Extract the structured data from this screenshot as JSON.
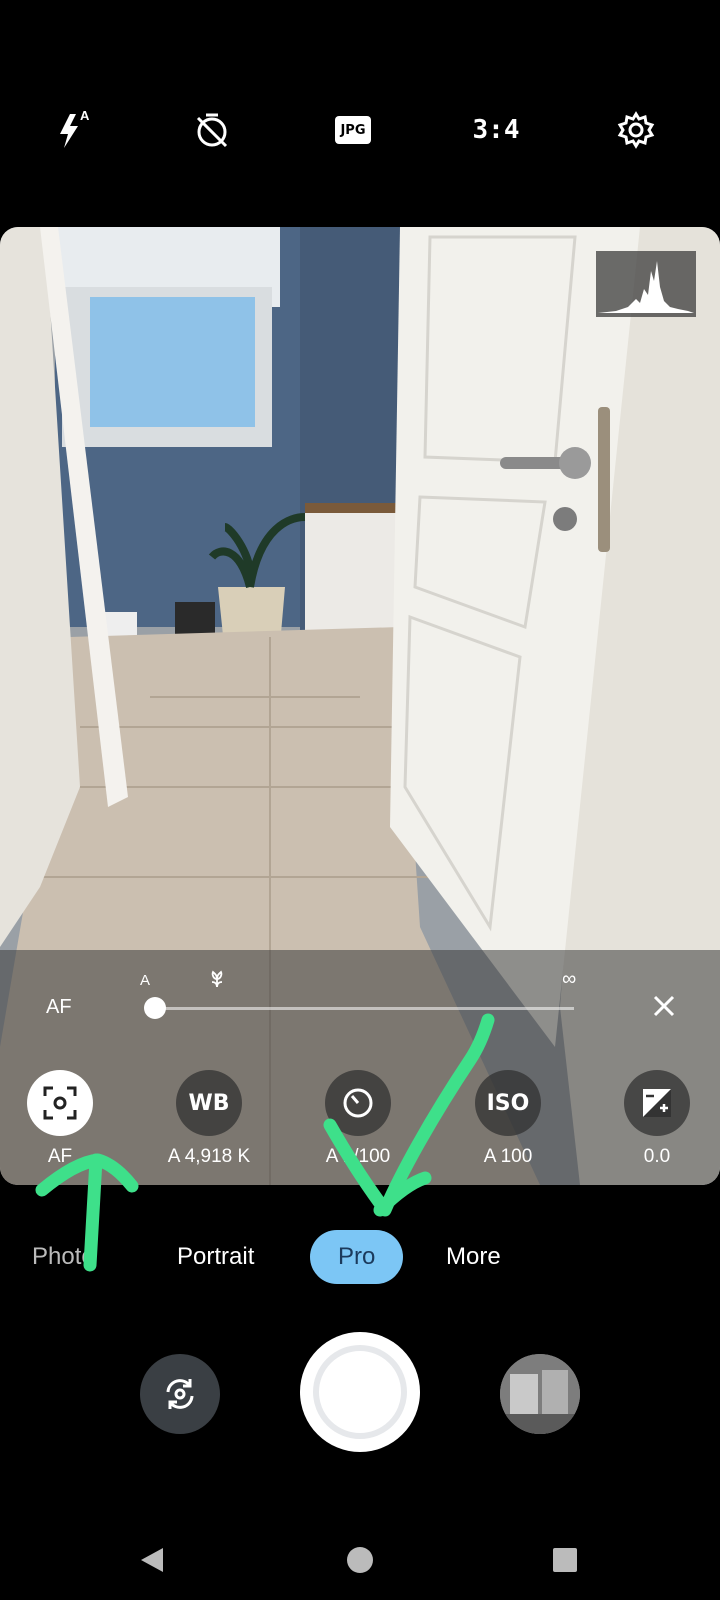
{
  "topbar": {
    "flash_icon": "flash-auto-icon",
    "flash_badge": "A",
    "timer_icon": "timer-off-icon",
    "format_label": "JPG",
    "aspect_ratio": "3:4",
    "settings_icon": "gear-icon"
  },
  "pro_panel": {
    "focus_mode_label": "AF",
    "slider_auto_label": "A",
    "slider_macro_icon": "flower-macro-icon",
    "slider_infinity_label": "∞",
    "close_icon": "close-icon",
    "focus_position": 0.02,
    "controls": [
      {
        "name": "AF",
        "icon": "focus-frame-icon",
        "value": "AF",
        "active": true
      },
      {
        "name": "WB",
        "label": "WB",
        "value": "A 4,918 K",
        "active": false
      },
      {
        "name": "shutter",
        "icon": "shutter-speed-icon",
        "value": "A 1/100",
        "active": false
      },
      {
        "name": "ISO",
        "label": "ISO",
        "value": "A 100",
        "active": false
      },
      {
        "name": "exposure",
        "icon": "exposure-compensation-icon",
        "value": "0.0",
        "active": false
      }
    ]
  },
  "modes": {
    "items": [
      "Photo",
      "Portrait",
      "Pro",
      "More"
    ],
    "selected": "Pro"
  },
  "capture": {
    "switch_icon": "camera-switch-icon",
    "shutter_icon": "shutter-button",
    "gallery_icon": "gallery-thumbnail"
  },
  "navbar": {
    "back_icon": "back-triangle-icon",
    "home_icon": "home-circle-icon",
    "recents_icon": "recents-square-icon"
  },
  "colors": {
    "accent": "#7cc6f5",
    "annotation": "#3ee08a"
  }
}
